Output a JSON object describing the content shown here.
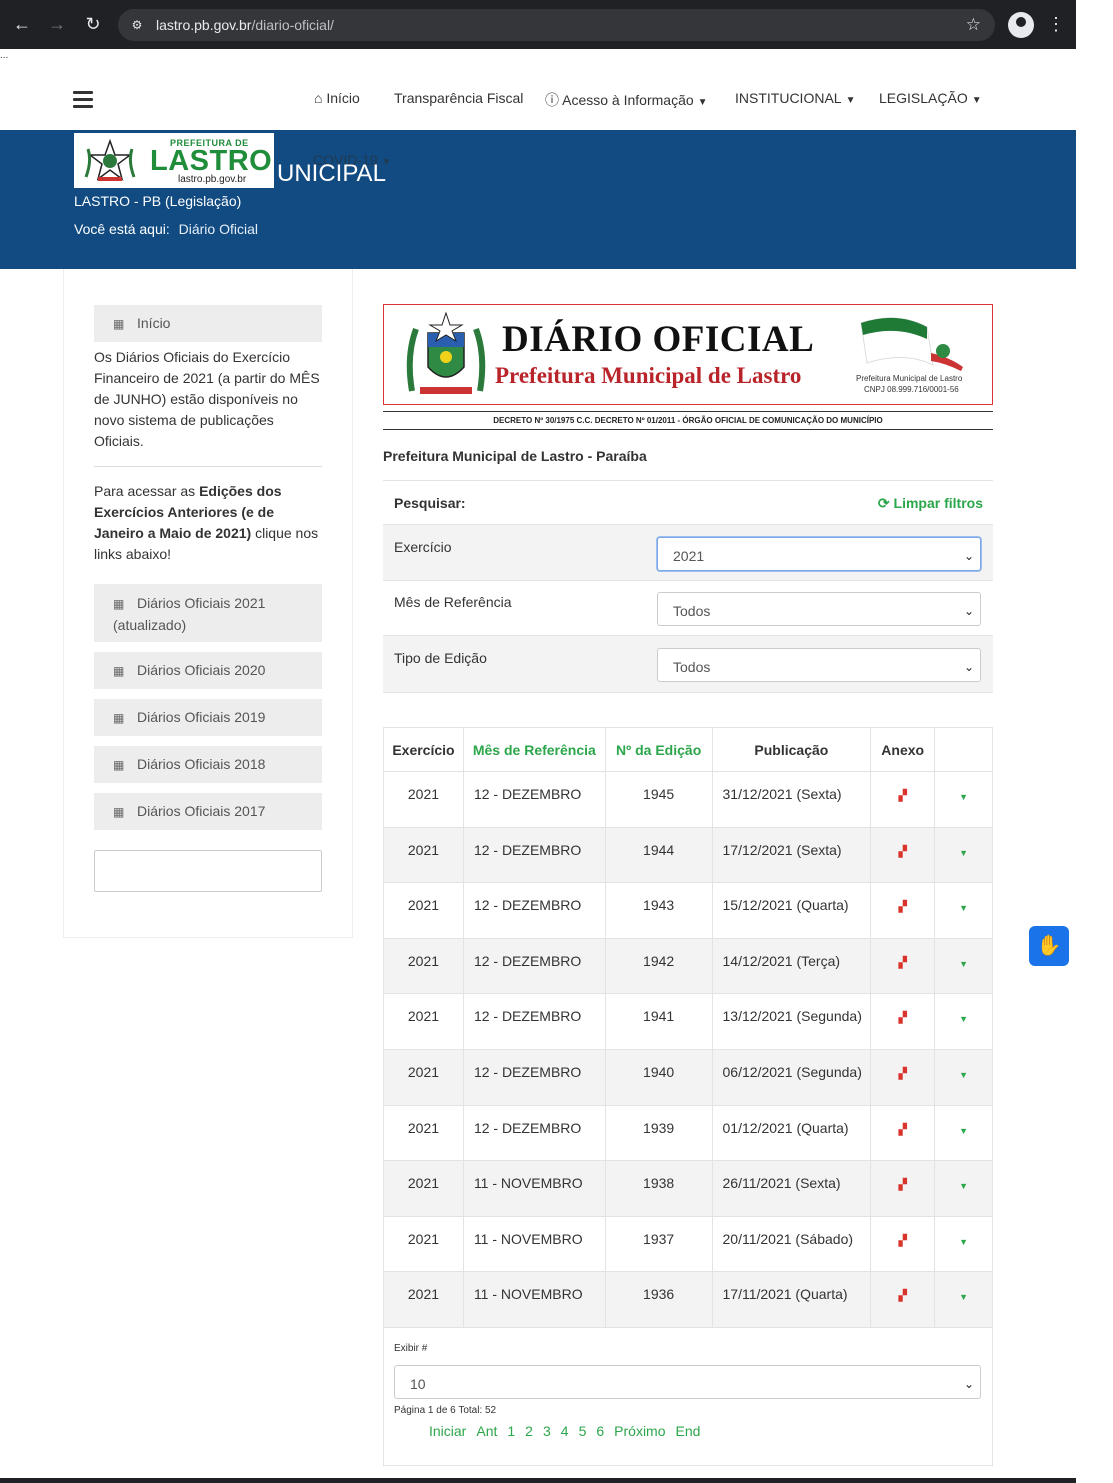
{
  "browser": {
    "url_host": "lastro.pb.gov.br",
    "url_path": "/diario-oficial/"
  },
  "topnav": {
    "items": [
      "Início",
      "Transparência Fiscal",
      "Acesso à Informação",
      "INSTITUCIONAL",
      "LEGISLAÇÃO"
    ],
    "covid": "COVID-19"
  },
  "banner": {
    "logo_pref": "PREFEITURA DE",
    "logo_name": "LASTRO",
    "logo_url": "lastro.pb.gov.br",
    "title_fragment": "UNICIPAL",
    "subtitle": "LASTRO - PB (Legislação)",
    "breadcrumb_label": "Você está aqui:",
    "breadcrumb_current": "Diário Oficial"
  },
  "sidebar": {
    "inicio": "Início",
    "para1": "Os Diários Oficiais do Exercício Financeiro de 2021 (a partir do MÊS de JUNHO) estão disponíveis no novo sistema de publicações Oficiais.",
    "para2_pre": "Para acessar as ",
    "para2_bold": "Edições dos Exercícios Anteriores (e de Janeiro a Maio de 2021)",
    "para2_post": " clique nos links abaixo!",
    "links": [
      "Diários Oficiais 2021 (atualizado)",
      "Diários Oficiais 2020",
      "Diários Oficiais 2019",
      "Diários Oficiais 2018",
      "Diários Oficiais 2017"
    ]
  },
  "header": {
    "title": "DIÁRIO OFICIAL",
    "subtitle": "Prefeitura Municipal de Lastro",
    "flag_line1": "Prefeitura Municipal de Lastro",
    "flag_line2": "CNPJ 08.999.716/0001-56",
    "decreto": "DECRETO Nº 30/1975 C.C. DECRETO Nº 01/2011 - ÓRGÃO OFICIAL DE COMUNICAÇÃO DO MUNICÍPIO"
  },
  "page_title": "Prefeitura Municipal de Lastro - Paraíba",
  "filters": {
    "search_label": "Pesquisar:",
    "clear_label": "Limpar filtros",
    "exercicio_label": "Exercício",
    "exercicio_value": "2021",
    "mes_label": "Mês de Referência",
    "mes_value": "Todos",
    "tipo_label": "Tipo de Edição",
    "tipo_value": "Todos"
  },
  "table": {
    "headers": [
      "Exercício",
      "Mês de Referência",
      "Nº da Edição",
      "Publicação",
      "Anexo",
      ""
    ],
    "rows": [
      [
        "2021",
        "12 - DEZEMBRO",
        "1945",
        "31/12/2021 (Sexta)"
      ],
      [
        "2021",
        "12 - DEZEMBRO",
        "1944",
        "17/12/2021 (Sexta)"
      ],
      [
        "2021",
        "12 - DEZEMBRO",
        "1943",
        "15/12/2021 (Quarta)"
      ],
      [
        "2021",
        "12 - DEZEMBRO",
        "1942",
        "14/12/2021 (Terça)"
      ],
      [
        "2021",
        "12 - DEZEMBRO",
        "1941",
        "13/12/2021 (Segunda)"
      ],
      [
        "2021",
        "12 - DEZEMBRO",
        "1940",
        "06/12/2021 (Segunda)"
      ],
      [
        "2021",
        "12 - DEZEMBRO",
        "1939",
        "01/12/2021 (Quarta)"
      ],
      [
        "2021",
        "11 - NOVEMBRO",
        "1938",
        "26/11/2021 (Sexta)"
      ],
      [
        "2021",
        "11 - NOVEMBRO",
        "1937",
        "20/11/2021 (Sábado)"
      ],
      [
        "2021",
        "11 - NOVEMBRO",
        "1936",
        "17/11/2021 (Quarta)"
      ]
    ]
  },
  "pagination": {
    "exibir_label": "Exibir #",
    "exibir_value": "10",
    "info": "Página 1 de 6 Total: 52",
    "links": [
      "Iniciar",
      "Ant",
      "1",
      "2",
      "3",
      "4",
      "5",
      "6",
      "Próximo",
      "End"
    ]
  },
  "colors": {
    "banner_blue": "#114b82",
    "accent_green": "#2ca64a",
    "header_red": "#b8242a"
  },
  "icons": [
    "home-icon",
    "info-circle-icon",
    "calendar-icon",
    "refresh-icon",
    "pdf-icon",
    "caret-down-icon",
    "sign-language-icon"
  ]
}
